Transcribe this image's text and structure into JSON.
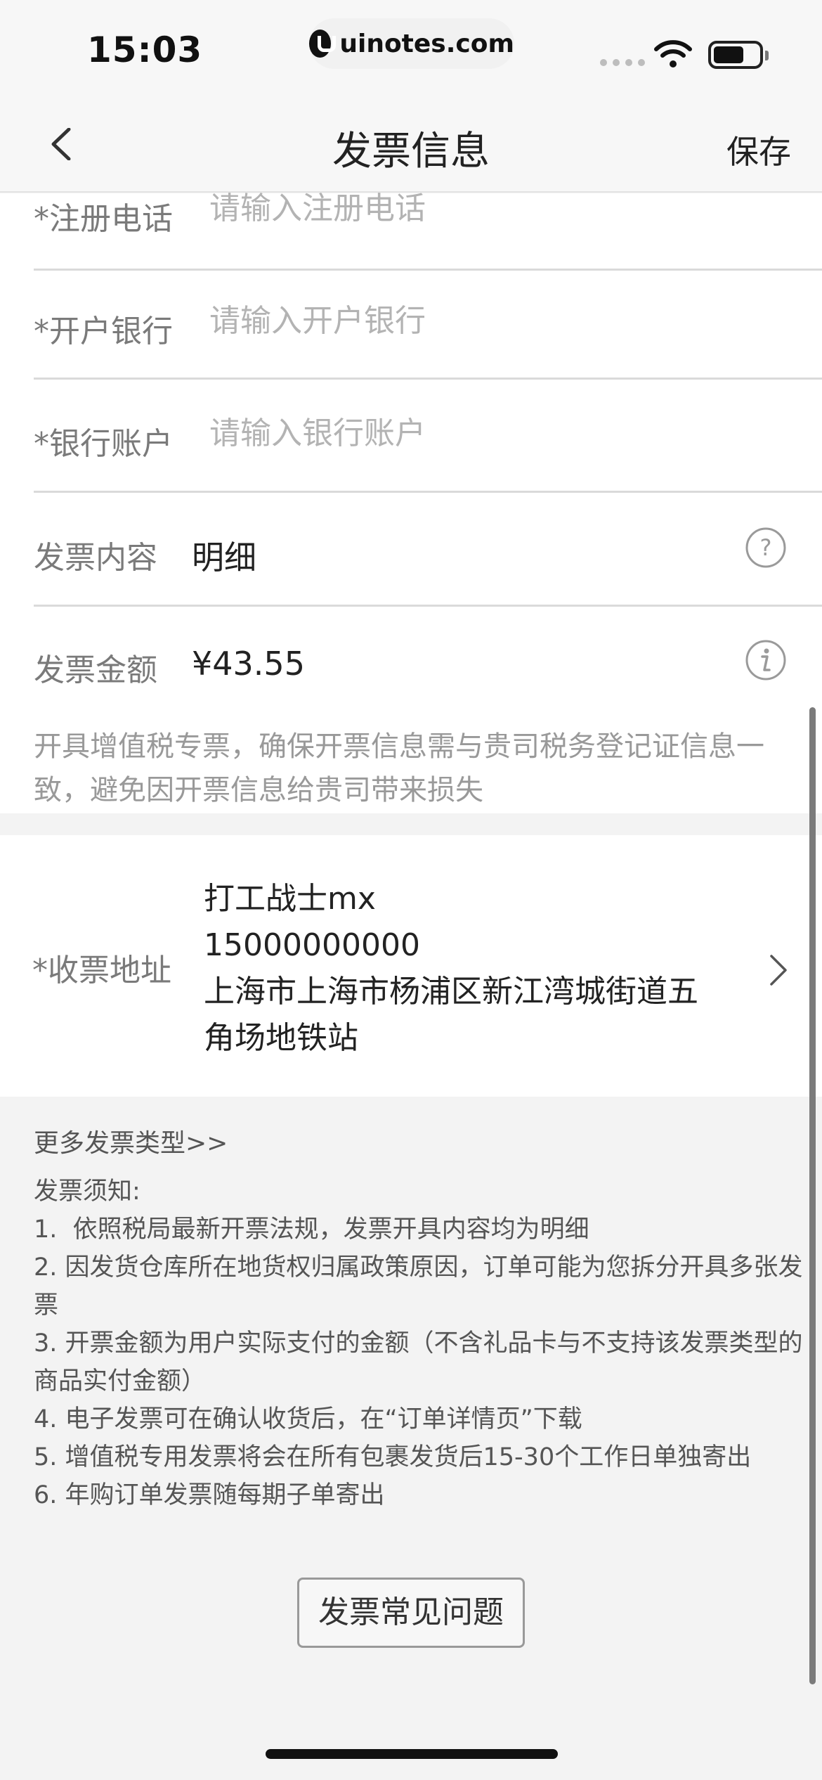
{
  "status_bar": {
    "time": "15:03",
    "url": "uinotes.com"
  },
  "nav": {
    "title": "发票信息",
    "save_label": "保存"
  },
  "form": {
    "fields": [
      {
        "label": "*注册电话",
        "placeholder": "请输入注册电话"
      },
      {
        "label": "*开户银行",
        "placeholder": "请输入开户银行"
      },
      {
        "label": "*银行账户",
        "placeholder": "请输入银行账户"
      }
    ],
    "content": {
      "label": "发票内容",
      "value": "明细"
    },
    "amount": {
      "label": "发票金额",
      "value": "¥43.55"
    },
    "notice": "开具增值税专票，确保开票信息需与贵司税务登记证信息一致，避免因开票信息给贵司带来损失"
  },
  "address": {
    "label": "*收票地址",
    "name": "打工战士mx",
    "phone": "15000000000",
    "line1": "上海市上海市杨浦区新江湾城街道五",
    "line2": "角场地铁站"
  },
  "footer": {
    "more_types": "更多发票类型>>",
    "notes_title": "发票须知:",
    "notes": [
      "1.  依照税局最新开票法规，发票开具内容均为明细",
      "2. 因发货仓库所在地货权归属政策原因，订单可能为您拆分开具多张发票",
      "3. 开票金额为用户实际支付的金额（不含礼品卡与不支持该发票类型的商品实付金额）",
      "4. 电子发票可在确认收货后，在“订单详情页”下载",
      "5. 增值税专用发票将会在所有包裹发货后15-30个工作日单独寄出",
      "6. 年购订单发票随每期子单寄出"
    ],
    "faq_label": "发票常见问题"
  },
  "icons": {
    "back": "chevron-left-icon",
    "help": "question-circle-icon",
    "info": "info-circle-icon",
    "chevron": "chevron-right-icon",
    "wifi": "wifi-icon",
    "battery": "battery-icon"
  }
}
